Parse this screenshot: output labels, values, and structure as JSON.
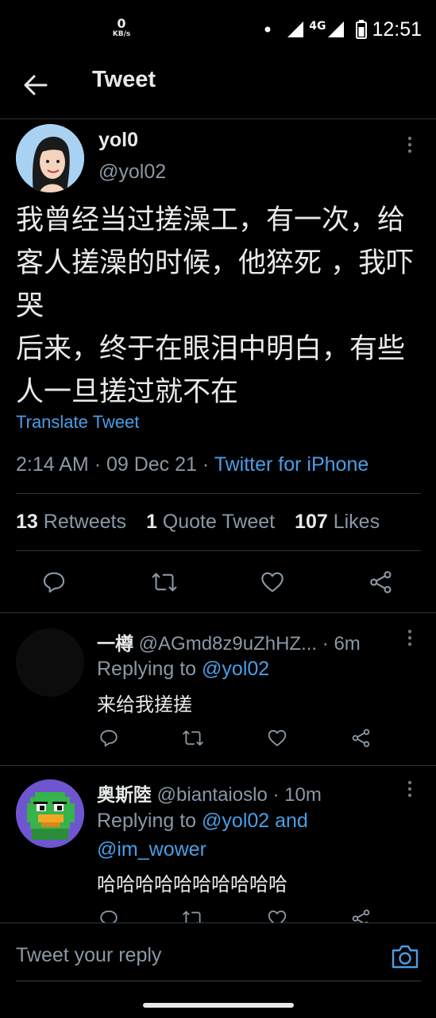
{
  "status_bar": {
    "speed_value": "0",
    "speed_unit": "KB/s",
    "network": "4G",
    "time": "12:51"
  },
  "header": {
    "title": "Tweet"
  },
  "tweet": {
    "author_name": "yol0",
    "author_handle": "@yol02",
    "text": "我曾经当过搓澡工，有一次，给客人搓澡的时候，他猝死 ，我吓哭\n后来，终于在眼泪中明白，有些人一旦搓过就不在",
    "translate_label": "Translate Tweet",
    "time": "2:14 AM",
    "date": "09 Dec 21",
    "source": "Twitter for iPhone",
    "retweets_count": "13",
    "retweets_label": "Retweets",
    "quotes_count": "1",
    "quotes_label": "Quote Tweet",
    "likes_count": "107",
    "likes_label": "Likes"
  },
  "replies": [
    {
      "name": "一樽",
      "handle": "@AGmd8z9uZhHZ...",
      "age": "6m",
      "replying_prefix": "Replying to",
      "mentions_1": "@yol02",
      "text": "来给我搓搓"
    },
    {
      "name": "奥斯陸",
      "handle": "@biantaioslo",
      "age": "10m",
      "replying_prefix": "Replying to",
      "mentions_1": "@yol02 and",
      "mentions_2": "@im_wower",
      "text": "哈哈哈哈哈哈哈哈哈哈"
    }
  ],
  "compose": {
    "placeholder": "Tweet your reply"
  },
  "icons": [
    "back-arrow-icon",
    "more-vertical-icon",
    "reply-icon",
    "retweet-icon",
    "like-icon",
    "share-icon",
    "camera-icon"
  ],
  "colors": {
    "background": "#000000",
    "text": "#e7e9ea",
    "secondary": "#8b98a5",
    "accent": "#4a9ee6",
    "divider": "#2f3336"
  }
}
